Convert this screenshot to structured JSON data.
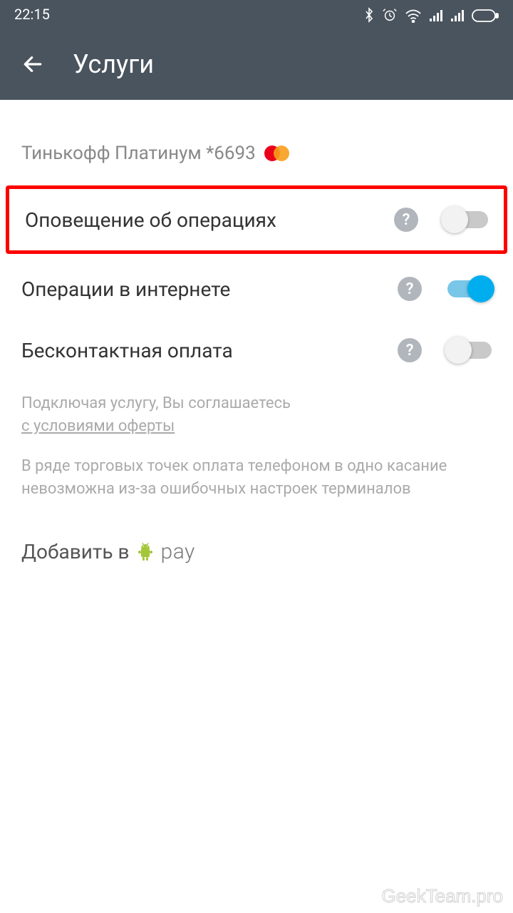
{
  "status": {
    "time": "22:15"
  },
  "appbar": {
    "title": "Услуги"
  },
  "card": {
    "name": "Тинькофф Платинум *6693"
  },
  "rows": [
    {
      "label": "Оповещение об операциях",
      "enabled": false,
      "highlighted": true
    },
    {
      "label": "Операции в интернете",
      "enabled": true,
      "highlighted": false
    },
    {
      "label": "Бесконтактная оплата",
      "enabled": false,
      "highlighted": false
    }
  ],
  "disclaimer": {
    "line1": "Подключая услугу, Вы соглашаетесь",
    "link": "с условиями оферты",
    "block2": "В ряде торговых точек оплата телефоном в одно касание невозможна из-за ошибочных настроек терминалов"
  },
  "addpay": {
    "prefix": "Добавить в",
    "paylabel": "pay"
  },
  "watermark": "GeekTeam.pro"
}
